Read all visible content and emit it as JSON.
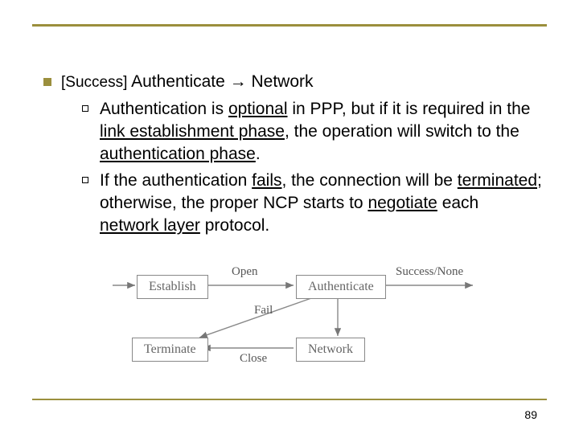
{
  "main": {
    "prefix": "[Success]",
    "head": "Authenticate → Network",
    "sub": [
      {
        "pre": "Authentication is ",
        "u1": "optional",
        "mid1": " in PPP, but if it is required in the ",
        "u2": "link establishment phase",
        "mid2": ", the operation will switch to the ",
        "u3": "authentication phase",
        "tail": "."
      },
      {
        "pre": "If the authentication ",
        "u1": "fails",
        "mid1": ", the connection will be ",
        "u2": "terminated",
        "mid2": "; otherwise, the proper NCP starts to ",
        "u3": "negotiate",
        "mid3": " each ",
        "u4": "network layer",
        "tail": " protocol."
      }
    ]
  },
  "diagram": {
    "boxes": {
      "establish": "Establish",
      "authenticate": "Authenticate",
      "terminate": "Terminate",
      "network": "Network"
    },
    "labels": {
      "open": "Open",
      "success": "Success/None",
      "fail": "Fail",
      "close": "Close"
    }
  },
  "page_number": "89"
}
